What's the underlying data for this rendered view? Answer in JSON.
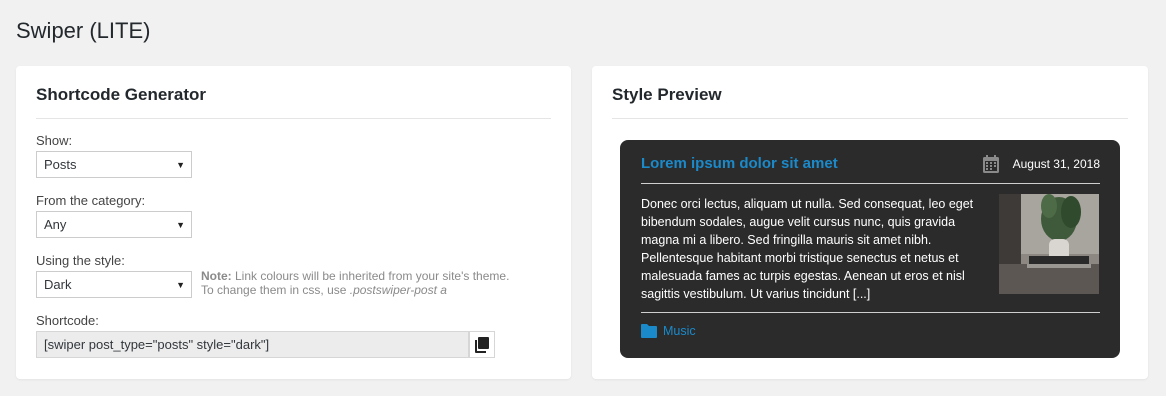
{
  "page": {
    "title": "Swiper (LITE)"
  },
  "generator": {
    "title": "Shortcode Generator",
    "show": {
      "label": "Show:",
      "value": "Posts"
    },
    "category": {
      "label": "From the category:",
      "value": "Any"
    },
    "style": {
      "label": "Using the style:",
      "value": "Dark"
    },
    "note": {
      "prefix": "Note:",
      "line1": " Link colours will be inherited from your site's theme.",
      "line2": "To change them in css, use ",
      "selector": ".postswiper-post a"
    },
    "shortcode": {
      "label": "Shortcode:",
      "value": "[swiper post_type=\"posts\" style=\"dark\"]"
    },
    "icons": {
      "dropdown": "chevron-down-icon",
      "copy": "copy-icon"
    }
  },
  "preview": {
    "title": "Style Preview",
    "post": {
      "title": "Lorem ipsum dolor sit amet",
      "date": "August 31, 2018",
      "body_lines": [
        "Donec orci lectus, aliquam ut nulla. Sed consequat, leo eget",
        "bibendum sodales, augue velit cursus nunc, quis gravida",
        "magna mi a libero. Sed fringilla mauris sit amet nibh.",
        "Pellentesque habitant morbi tristique senectus et netus et",
        "malesuada fames ac turpis egestas. Aenean ut eros et nisl",
        "sagittis vestibulum. Ut varius tincidunt [...]"
      ],
      "category": "Music",
      "icons": {
        "date": "calendar-icon",
        "category": "folder-icon",
        "image": "thumbnail-image"
      }
    },
    "colors": {
      "card_bg": "#2b2b2b",
      "link": "#1a8acb"
    }
  }
}
